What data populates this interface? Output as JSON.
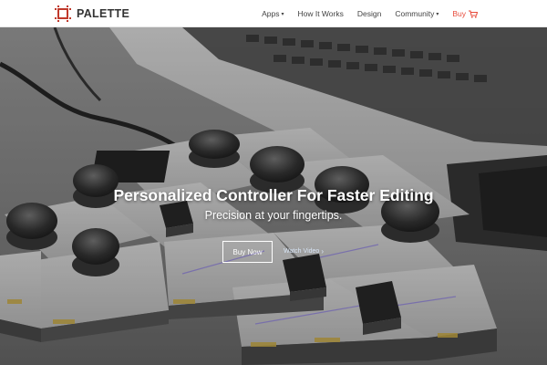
{
  "brand": {
    "name": "PALETTE",
    "accent": "#c0392b"
  },
  "nav": {
    "items": [
      {
        "label": "Apps",
        "has_caret": true
      },
      {
        "label": "How It Works",
        "has_caret": false
      },
      {
        "label": "Design",
        "has_caret": false
      },
      {
        "label": "Community",
        "has_caret": true
      },
      {
        "label": "Buy",
        "has_caret": false,
        "icon": "cart-icon",
        "color": "#e74c3c"
      }
    ],
    "caret_glyph": "▾"
  },
  "hero": {
    "title": "Personalized Controller For Faster Editing",
    "subtitle": "Precision at your fingertips.",
    "primary_button": "Buy Now",
    "secondary_link": "Watch Video",
    "secondary_chevron": "›"
  }
}
